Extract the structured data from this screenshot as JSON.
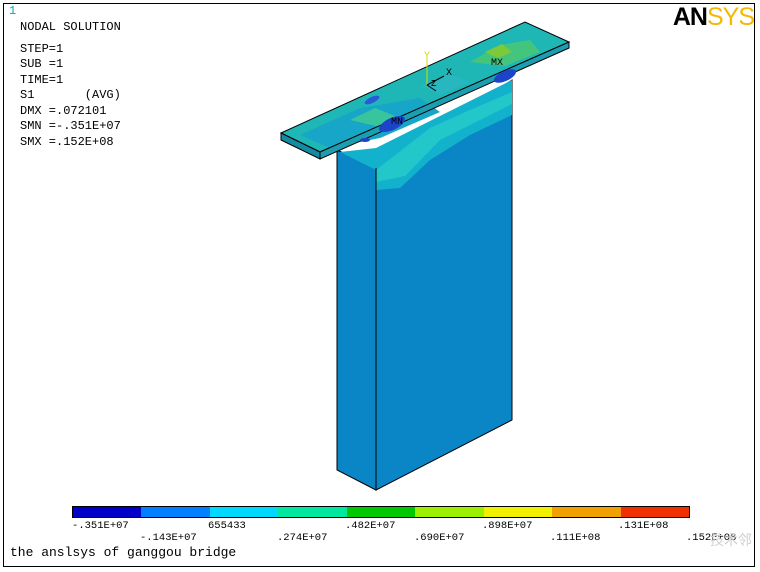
{
  "window_number": "1",
  "brand": {
    "an": "AN",
    "sys": "SYS"
  },
  "info": {
    "title": "NODAL SOLUTION",
    "step": "STEP=1",
    "sub": "SUB =1",
    "time": "TIME=1",
    "result": "S1       (AVG)",
    "dmx": "DMX =.072101",
    "smn": "SMN =-.351E+07",
    "smx": "SMX =.152E+08"
  },
  "markers": {
    "mx": "MX",
    "mn": "MN",
    "axis_y": "Y",
    "axis_x": "X",
    "axis_z": "Z"
  },
  "legend": {
    "colors": [
      "#0000c8",
      "#0080ff",
      "#00d8ff",
      "#00e8a0",
      "#00c800",
      "#9bef00",
      "#f0f000",
      "#f0a000",
      "#f03000"
    ],
    "upper_ticks": [
      ".351E+07",
      "655433",
      ".482E+07",
      ".898E+07",
      ".131E+08"
    ],
    "lower_ticks": [
      "-.143E+07",
      ".274E+07",
      ".690E+07",
      ".111E+08",
      ".152E+08"
    ],
    "upper_first": "-.351E+07"
  },
  "caption": "the anslsys of ganggou bridge",
  "watermark": "技术邻"
}
